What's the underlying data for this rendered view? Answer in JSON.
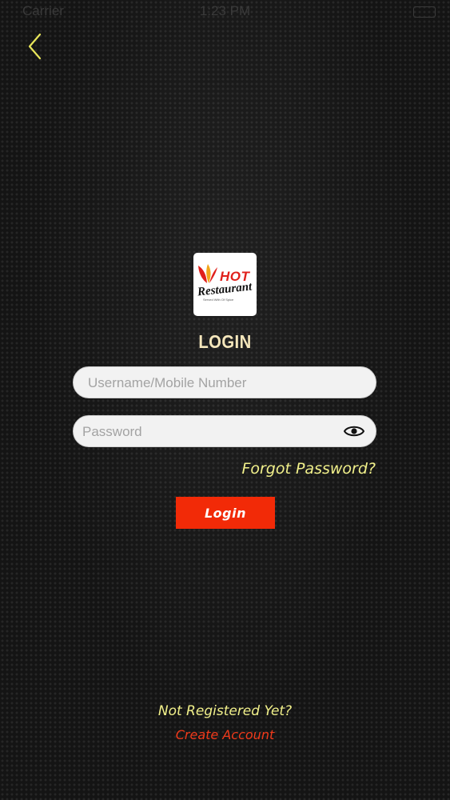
{
  "status_bar": {
    "carrier": "Carrier",
    "time": "1:23 PM"
  },
  "logo": {
    "word_hot": "HOT",
    "word_restaurant": "Restaurant",
    "tagline": "Served With Of Spice"
  },
  "login": {
    "title": "LOGIN",
    "username_placeholder": "Username/Mobile Number",
    "password_placeholder": "Password",
    "forgot_password": "Forgot Password?",
    "button_label": "Login"
  },
  "register": {
    "prompt": "Not Registered Yet?",
    "create_account": "Create Account"
  },
  "icons": {
    "back": "chevron-left-icon",
    "password_visibility": "eye-icon"
  },
  "colors": {
    "back_arrow": "#e8e65a",
    "title": "#f4e6bb",
    "link_yellow": "#f1f08a",
    "accent_red": "#f22a07",
    "create_account": "#f03a1b"
  }
}
